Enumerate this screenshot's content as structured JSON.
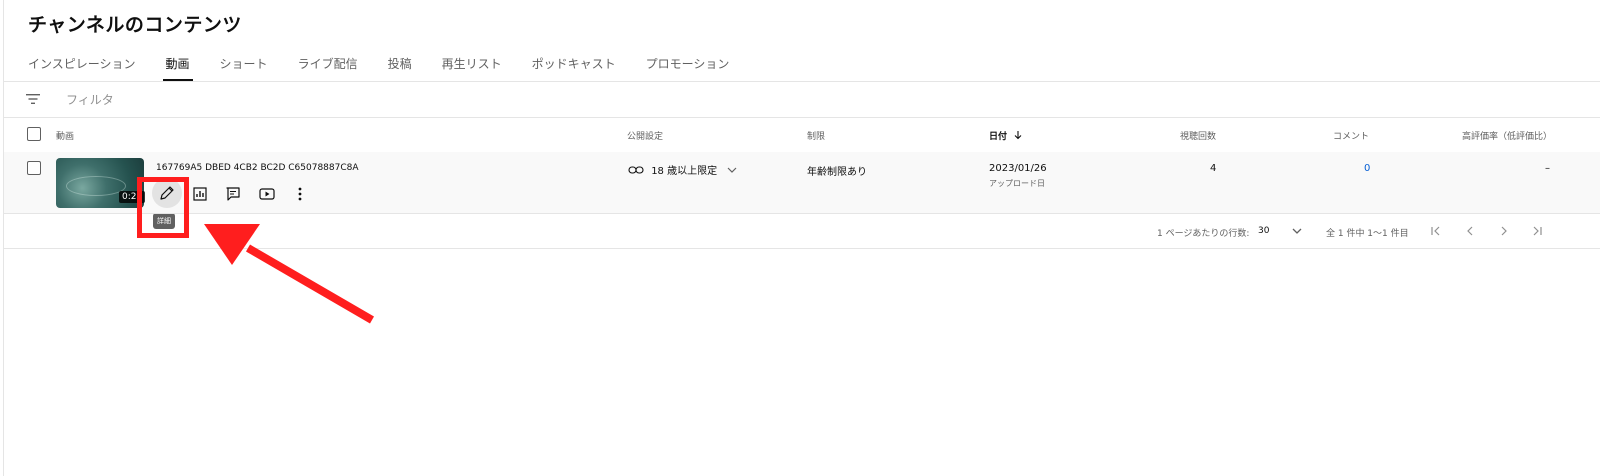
{
  "page_title": "チャンネルのコンテンツ",
  "tabs": [
    {
      "label": "インスピレーション"
    },
    {
      "label": "動画"
    },
    {
      "label": "ショート"
    },
    {
      "label": "ライブ配信"
    },
    {
      "label": "投稿"
    },
    {
      "label": "再生リスト"
    },
    {
      "label": "ポッドキャスト"
    },
    {
      "label": "プロモーション"
    }
  ],
  "active_tab": "動画",
  "filter": {
    "placeholder": "フィルタ",
    "icon": "filter-icon"
  },
  "table": {
    "headers": {
      "video": "動画",
      "visibility": "公開設定",
      "restrictions": "制限",
      "date": "日付",
      "views": "視聴回数",
      "comments": "コメント",
      "likes": "高評価率（低評価比）"
    },
    "sort_icon": "arrow-down-icon",
    "rows": [
      {
        "duration": "0:24",
        "title": "167769A5 DBED 4CB2 BC2D C65078887C8A",
        "visibility": "18 歳以上限定",
        "restriction": "年齢制限あり",
        "date": "2023/01/26",
        "date_sub": "アップロード日",
        "views": "4",
        "comments": "0",
        "likes": "–"
      }
    ],
    "row_actions": {
      "edit_tooltip": "詳細",
      "icons": [
        "pencil-icon",
        "analytics-icon",
        "comments-icon",
        "youtube-icon",
        "more-vert-icon"
      ]
    }
  },
  "pagination": {
    "rows_per_page_label": "1 ページあたりの行数:",
    "rows_per_page_value": "30",
    "range": "全 1 件中 1〜1 件目"
  },
  "annotation": {
    "color": "#ff1e1e"
  }
}
